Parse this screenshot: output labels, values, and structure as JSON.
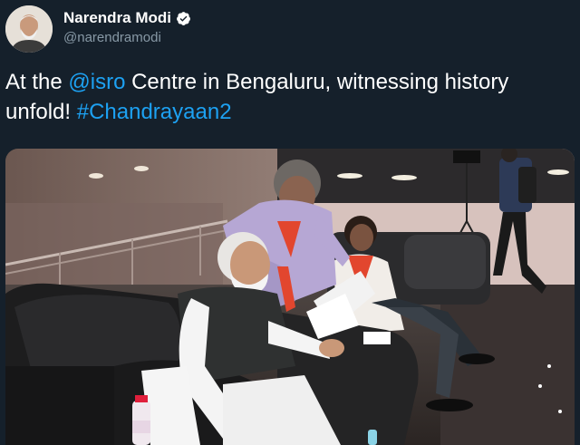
{
  "author": {
    "name": "Narendra Modi",
    "handle": "@narendramodi",
    "verified": true,
    "avatar_icon": "person-avatar"
  },
  "tweet": {
    "text_1": "At the ",
    "mention": "@isro",
    "text_2": " Centre in Bengaluru, witnessing history unfold! ",
    "hashtag": "#Chandrayaan2"
  },
  "media": {
    "type": "photo",
    "description_icon": "photo-icon"
  },
  "colors": {
    "background": "#15202b",
    "link": "#1da1f2",
    "secondary_text": "#8899a6",
    "verified_badge": "#ffffff"
  }
}
